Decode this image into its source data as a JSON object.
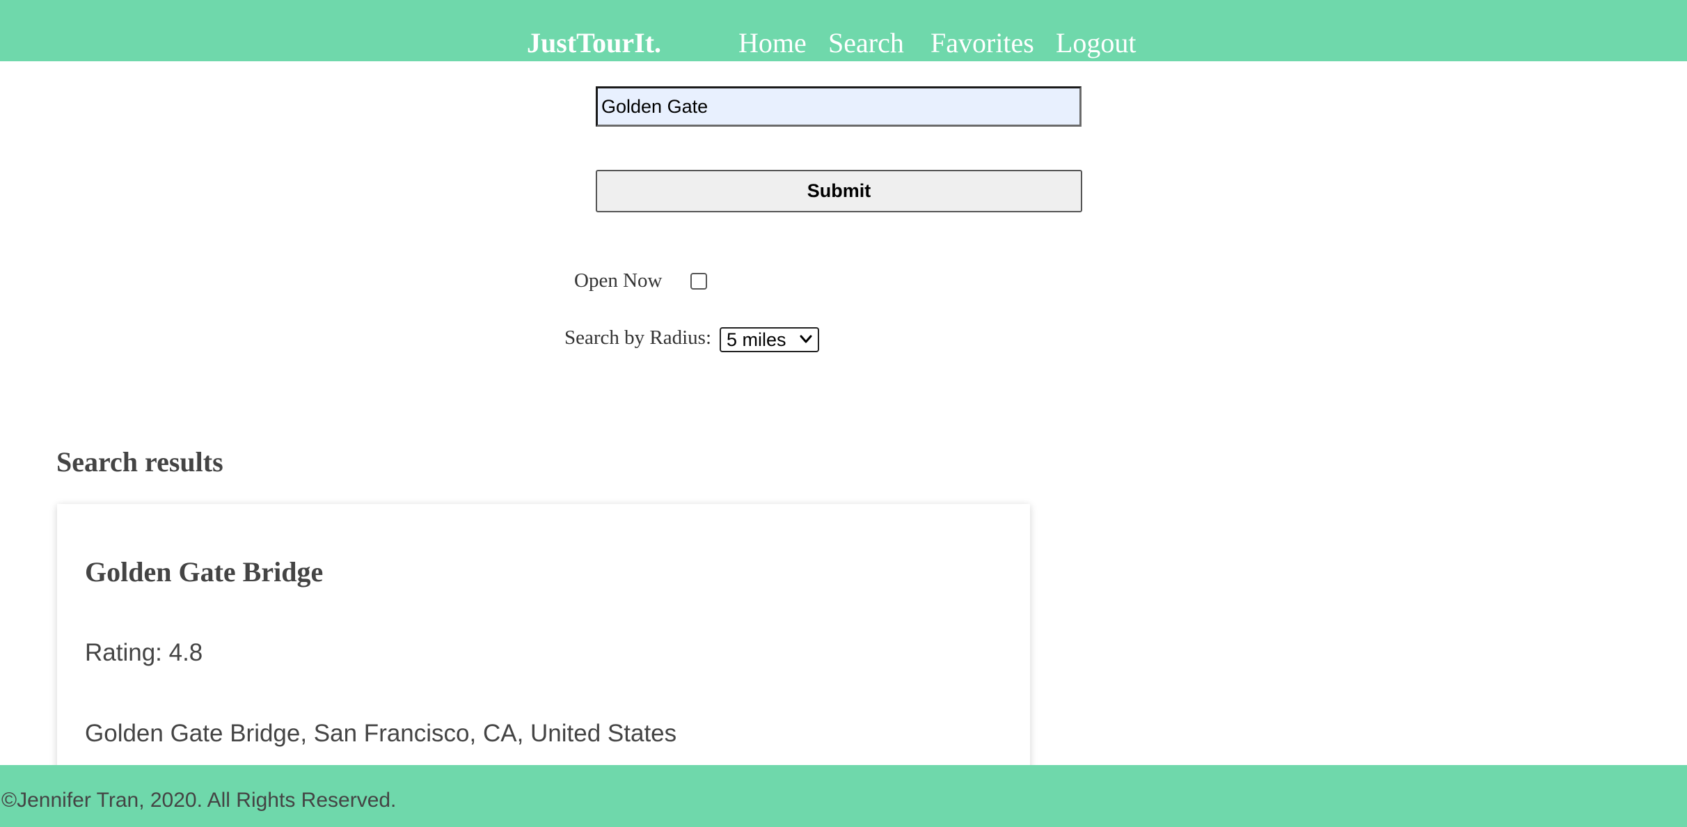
{
  "navbar": {
    "brand": "JustTourIt.",
    "links": {
      "home": "Home",
      "search": "Search",
      "favorites": "Favorites",
      "logout": "Logout"
    },
    "background_color": "#6fd8ab"
  },
  "search_form": {
    "query_value": "Golden Gate",
    "submit_label": "Submit",
    "open_now_label": "Open Now",
    "open_now_checked": false,
    "radius_label": "Search by Radius:",
    "radius_selected": "5 miles"
  },
  "results": {
    "heading": "Search results",
    "items": [
      {
        "name": "Golden Gate Bridge",
        "rating": "Rating: 4.8",
        "address": "Golden Gate Bridge, San Francisco, CA, United States"
      }
    ]
  },
  "footer": {
    "copyright": "©Jennifer Tran, 2020. All Rights Reserved."
  }
}
